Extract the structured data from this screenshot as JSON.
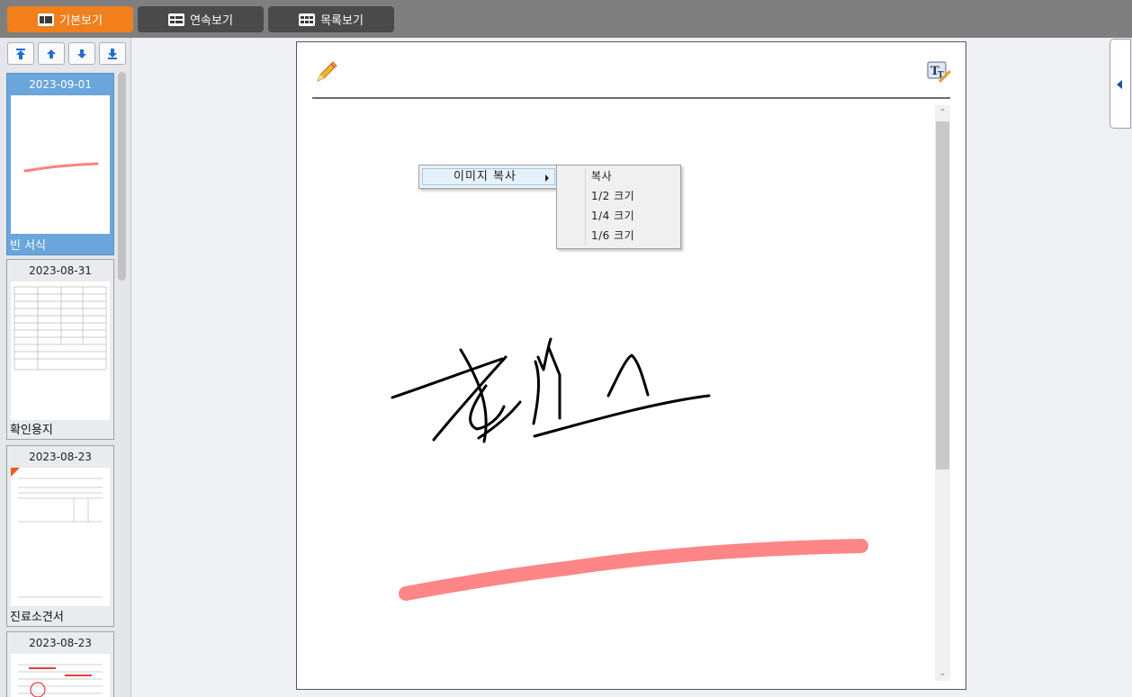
{
  "tabs": [
    {
      "label": "기본보기",
      "active": true
    },
    {
      "label": "연속보기",
      "active": false
    },
    {
      "label": "목록보기",
      "active": false
    }
  ],
  "nav_buttons": [
    "move-top",
    "move-up",
    "move-down",
    "move-bottom"
  ],
  "thumbnails": [
    {
      "date": "2023-09-01",
      "label": "빈 서식",
      "selected": true
    },
    {
      "date": "2023-08-31",
      "label": "확인용지",
      "selected": false
    },
    {
      "date": "2023-08-23",
      "label": "진료소견서",
      "selected": false
    },
    {
      "date": "2023-08-23",
      "label": "",
      "selected": false
    }
  ],
  "context_menu": {
    "item": "이미지 복사",
    "submenu": [
      "복사",
      "1/2 크기",
      "1/4 크기",
      "1/6 크기"
    ]
  },
  "colors": {
    "accent": "#f07f1c",
    "tab_inactive": "#4a4a4a",
    "selected_thumb": "#6aa5dc",
    "highlight_stroke": "#ff8080"
  },
  "icons": {
    "pencil": "pencil-icon",
    "text_tool": "text-tool-icon",
    "collapse": "chevron-left-icon"
  }
}
